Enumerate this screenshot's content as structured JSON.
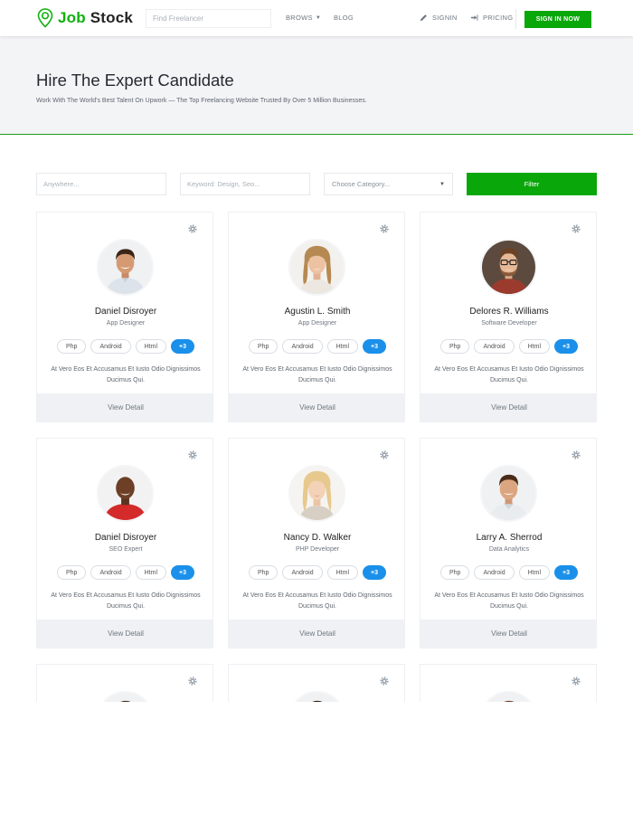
{
  "brand": {
    "name_part1": "Job",
    "name_part2": "Stock",
    "accent_color": "#0eb10e"
  },
  "header": {
    "search_placeholder": "Find Freelancer",
    "nav": {
      "browse": "BROWS",
      "blog": "BLOG",
      "signin": "SIGNIN",
      "pricing": "PRICING"
    },
    "signin_now_label": "SIGN IN NOW"
  },
  "hero": {
    "title": "Hire The Expert Candidate",
    "subtitle": "Work With The World's Best Talent On Upwork — The Top Freelancing Website Trusted By Over 5 Million Businesses."
  },
  "filter": {
    "location_placeholder": "Anywhere...",
    "keyword_placeholder": "Keyword: Design, Seo...",
    "category_placeholder": "Choose Category...",
    "button_label": "Filter"
  },
  "candidates": [
    {
      "name": "Daniel Disroyer",
      "role": "App Designer",
      "skills": [
        "Php",
        "Android",
        "Html",
        "+3"
      ],
      "desc": "At Vero Eos Et Accusamus Et Iusto Odio Dignissimos Ducimus Qui.",
      "button": "View Detail"
    },
    {
      "name": "Agustin L. Smith",
      "role": "App Designer",
      "skills": [
        "Php",
        "Android",
        "Html",
        "+3"
      ],
      "desc": "At Vero Eos Et Accusamus Et Iusto Odio Dignissimos Ducimus Qui.",
      "button": "View Detail"
    },
    {
      "name": "Delores R. Williams",
      "role": "Software Developer",
      "skills": [
        "Php",
        "Android",
        "Html",
        "+3"
      ],
      "desc": "At Vero Eos Et Accusamus Et Iusto Odio Dignissimos Ducimus Qui.",
      "button": "View Detail"
    },
    {
      "name": "Daniel Disroyer",
      "role": "SEO Expert",
      "skills": [
        "Php",
        "Android",
        "Html",
        "+3"
      ],
      "desc": "At Vero Eos Et Accusamus Et Iusto Odio Dignissimos Ducimus Qui.",
      "button": "View Detail"
    },
    {
      "name": "Nancy D. Walker",
      "role": "PHP Developer",
      "skills": [
        "Php",
        "Android",
        "Html",
        "+3"
      ],
      "desc": "At Vero Eos Et Accusamus Et Iusto Odio Dignissimos Ducimus Qui.",
      "button": "View Detail"
    },
    {
      "name": "Larry A. Sherrod",
      "role": "Data Analytics",
      "skills": [
        "Php",
        "Android",
        "Html",
        "+3"
      ],
      "desc": "At Vero Eos Et Accusamus Et Iusto Odio Dignissimos Ducimus Qui.",
      "button": "View Detail"
    }
  ],
  "colors": {
    "green": "#0aa70a",
    "blue": "#1a90ea",
    "hero_bg": "#f3f4f6"
  }
}
